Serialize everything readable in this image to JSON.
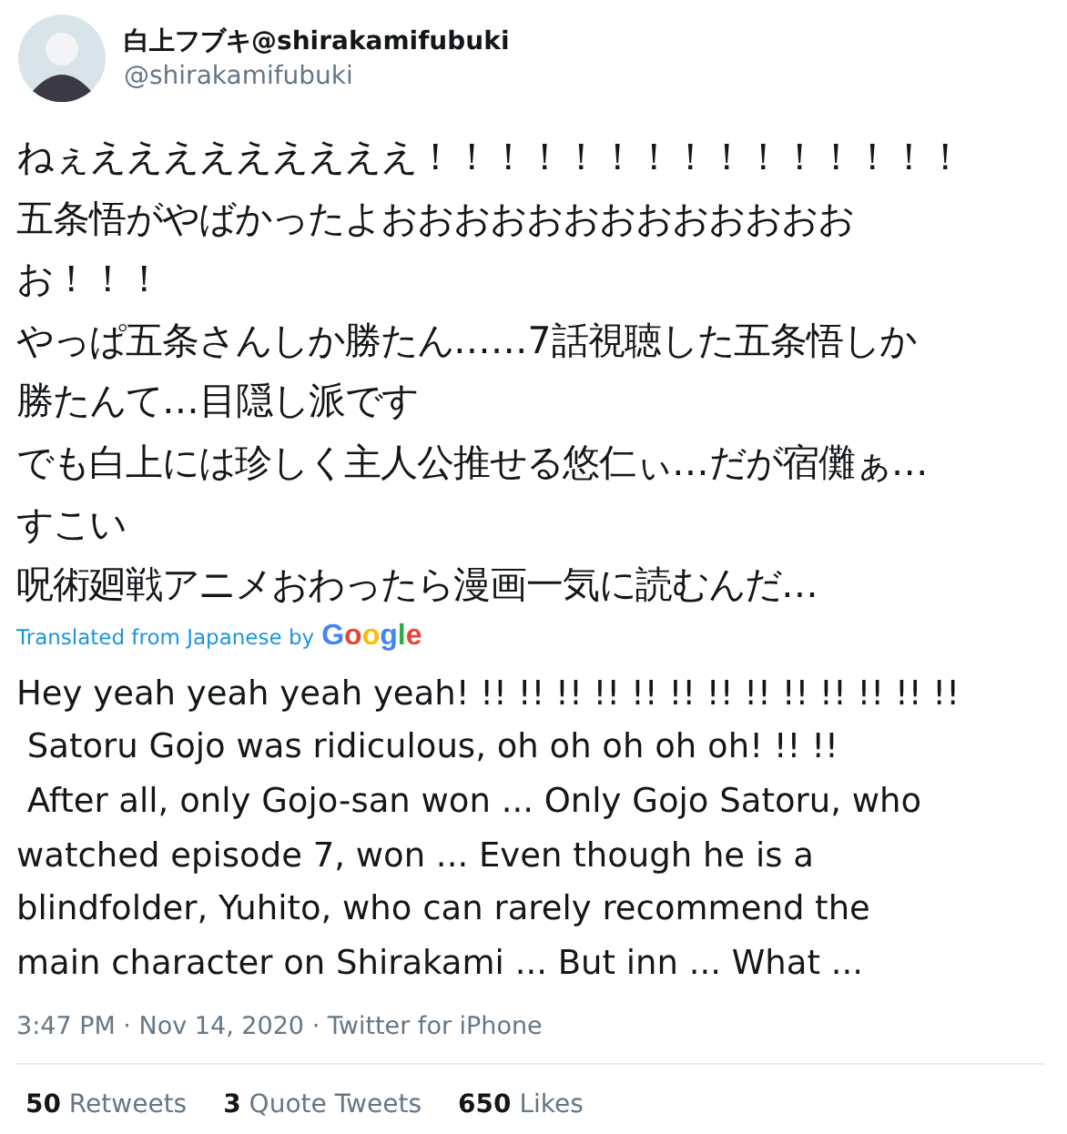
{
  "author": {
    "display_name": "白上フブキ@shirakamifubuki",
    "handle": "@shirakamifubuki"
  },
  "tweet_lines": [
    "ねぇえええええええええ！！！！！！！！！！！！！！！",
    "五条悟がやばかったよおおおおおおおおおおおおお",
    "お！！！",
    "やっぱ五条さんしか勝たん……7話視聴した五条悟しか",
    "勝たんて…目隠し派です",
    "でも白上には珍しく主人公推せる悠仁ぃ…だが宿儺ぁ…",
    "すこい",
    "呪術廻戦アニメおわったら漫画一気に読むんだ…"
  ],
  "translation": {
    "label": "Translated from Japanese by",
    "provider": "Google",
    "lines": [
      "Hey yeah yeah yeah yeah! !! !! !! !! !! !! !! !! !! !! !! !! !!",
      " Satoru Gojo was ridiculous, oh oh oh oh oh! !! !!",
      " After all, only Gojo-san won ... Only Gojo Satoru, who",
      "watched episode 7, won ... Even though he is a",
      "blindfolder, Yuhito, who can rarely recommend the",
      "main character on Shirakami ... But inn ... What ..."
    ]
  },
  "timestamp": "3:47 PM · Nov 14, 2020 · Twitter for iPhone",
  "stats": [
    {
      "count": "50",
      "label": "Retweets"
    },
    {
      "count": "3",
      "label": "Quote Tweets"
    },
    {
      "count": "650",
      "label": "Likes"
    }
  ]
}
